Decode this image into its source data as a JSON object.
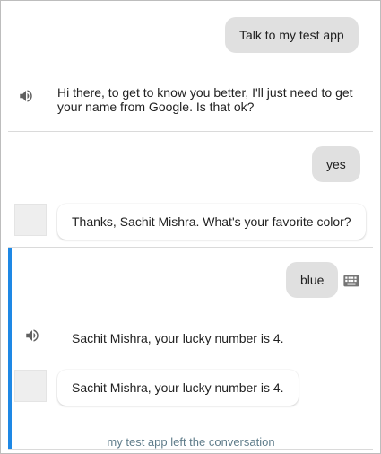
{
  "colors": {
    "accent": "#1e88e5",
    "user_bubble": "#e0e0e0",
    "divider": "#dadada",
    "system_text": "#607d8b"
  },
  "turns": [
    {
      "user": "Talk to my test app",
      "agent_speech": "Hi there, to get to know you better, I'll just need to get your name from Google. Is that ok?",
      "icon": "speaker-icon"
    },
    {
      "user": "yes",
      "agent_card": "Thanks, Sachit Mishra. What's your favorite color?"
    },
    {
      "user": "blue",
      "input_icon": "keyboard-icon",
      "agent_speech": "Sachit Mishra, your lucky number is 4.",
      "agent_card": "Sachit Mishra, your lucky number is 4.",
      "icon": "speaker-icon"
    }
  ],
  "system_message": "my test app left the conversation"
}
